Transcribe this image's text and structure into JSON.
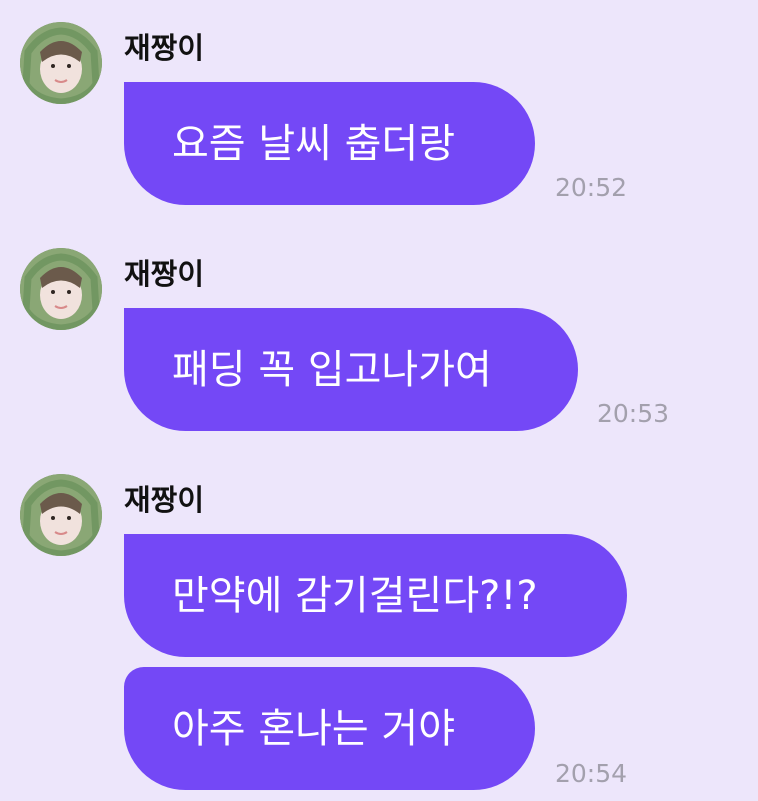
{
  "colors": {
    "background": "#ede6fb",
    "bubble": "#7448f6",
    "bubble_text": "#ffffff",
    "sender_text": "#111111",
    "time_text": "#a3a0ad"
  },
  "messages": [
    {
      "sender": "재짱이",
      "avatar_icon": "profile-photo",
      "bubbles": [
        "요즘 날씨 춥더랑"
      ],
      "time": "20:52"
    },
    {
      "sender": "재짱이",
      "avatar_icon": "profile-photo",
      "bubbles": [
        "패딩 꼭 입고나가여"
      ],
      "time": "20:53"
    },
    {
      "sender": "재짱이",
      "avatar_icon": "profile-photo",
      "bubbles": [
        "만약에 감기걸린다?!?",
        "아주 혼나는 거야"
      ],
      "time": "20:54"
    }
  ]
}
